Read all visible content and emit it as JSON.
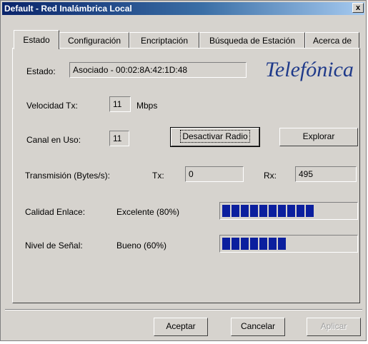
{
  "window": {
    "title": "Default - Red Inalámbrica Local",
    "close_label": "x"
  },
  "tabs": [
    {
      "label": "Estado",
      "active": true
    },
    {
      "label": "Configuración",
      "active": false
    },
    {
      "label": "Encriptación",
      "active": false
    },
    {
      "label": "Búsqueda de Estación",
      "active": false
    },
    {
      "label": "Acerca de",
      "active": false
    }
  ],
  "status": {
    "estado_label": "Estado:",
    "estado_value": "Asociado - 00:02:8A:42:1D:48",
    "logo": "Telefónica",
    "tx_speed_label": "Velocidad Tx:",
    "tx_speed_value": "11",
    "tx_speed_unit": "Mbps",
    "channel_label": "Canal en Uso:",
    "channel_value": "11",
    "transmission_label": "Transmisión (Bytes/s):",
    "tx_label": "Tx:",
    "tx_value": "0",
    "rx_label": "Rx:",
    "rx_value": "495",
    "link_quality_label": "Calidad Enlace:",
    "link_quality_value": "Excelente (80%)",
    "link_quality_fraction": 0.8,
    "signal_label": "Nivel de Señal:",
    "signal_value": "Bueno (60%)",
    "signal_fraction": 0.6
  },
  "buttons": {
    "disable_radio": "Desactivar Radio",
    "explore": "Explorar",
    "accept": "Aceptar",
    "cancel": "Cancelar",
    "apply": "Aplicar"
  },
  "colors": {
    "titlebar": "#0a246a",
    "bar_fill": "#0b1f9e",
    "logo": "#1f3a8a"
  }
}
